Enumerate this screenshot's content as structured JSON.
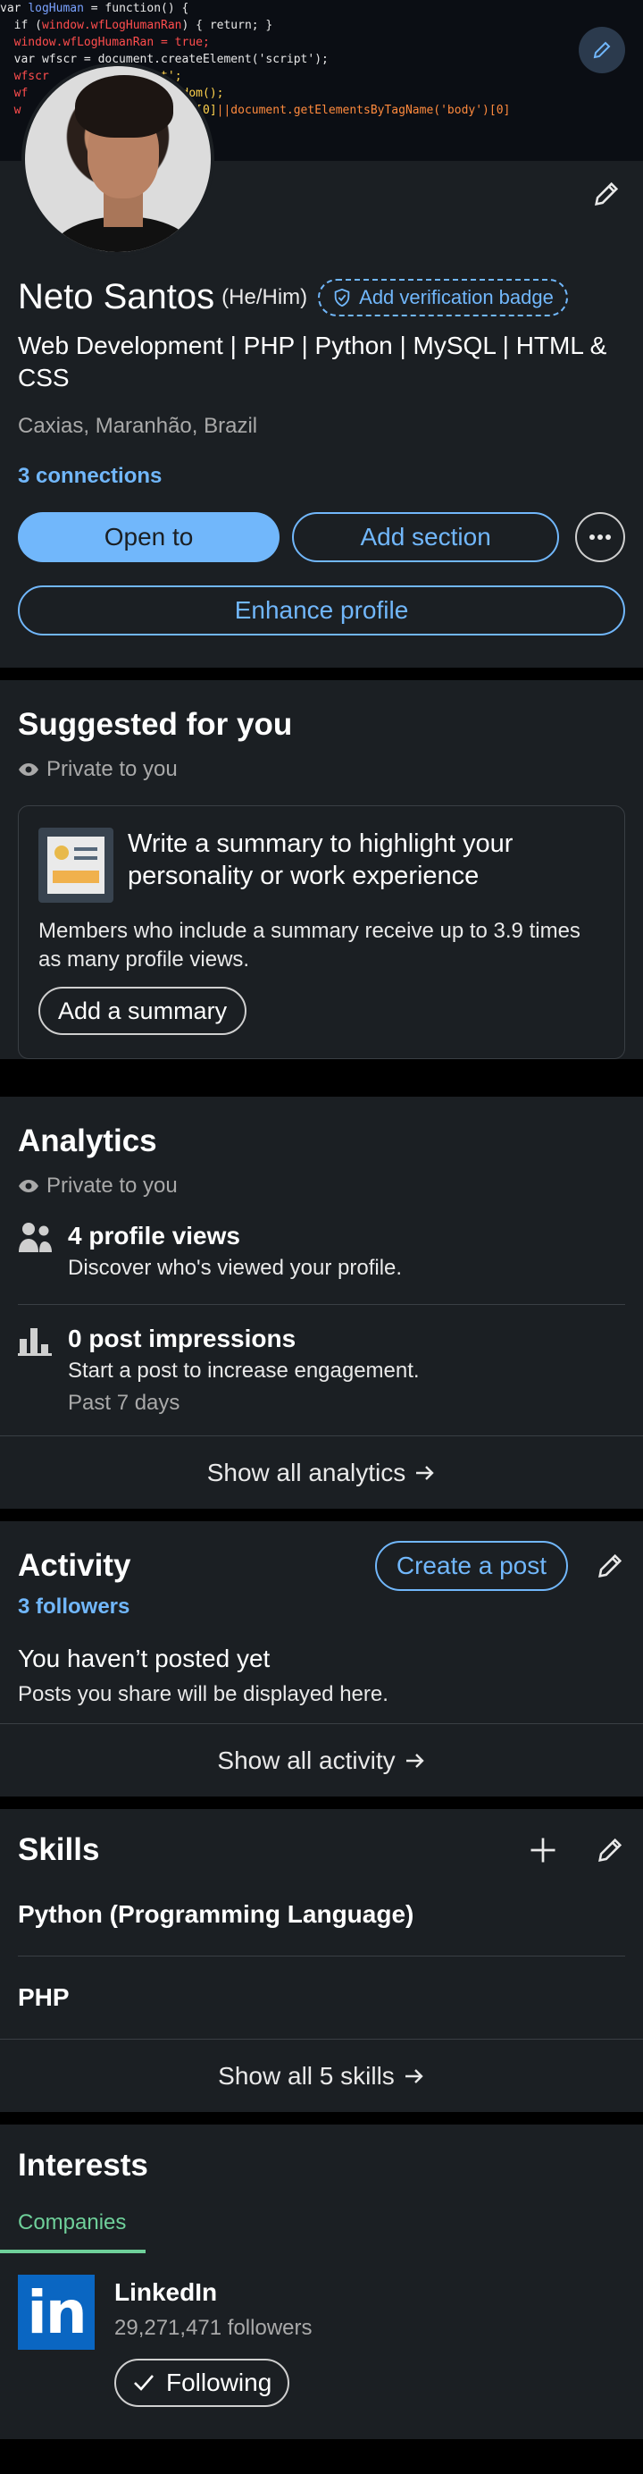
{
  "profile": {
    "name": "Neto Santos",
    "pronouns": "(He/Him)",
    "verification_badge": "Add verification badge",
    "headline": "Web Development | PHP | Python | MySQL | HTML & CSS",
    "location": "Caxias, Maranhão, Brazil",
    "connections": "3 connections",
    "buttons": {
      "open_to": "Open to",
      "add_section": "Add section",
      "enhance": "Enhance profile"
    }
  },
  "suggested": {
    "title": "Suggested for you",
    "privacy": "Private to you",
    "card_title": "Write a summary to highlight your personality or work experience",
    "card_body": "Members who include a summary receive up to 3.9 times as many profile views.",
    "card_button": "Add a summary"
  },
  "analytics": {
    "title": "Analytics",
    "privacy": "Private to you",
    "items": [
      {
        "title": "4 profile views",
        "desc": "Discover who's viewed your profile.",
        "note": ""
      },
      {
        "title": "0 post impressions",
        "desc": "Start a post to increase engagement.",
        "note": "Past 7 days"
      }
    ],
    "show_all": "Show all analytics"
  },
  "activity": {
    "title": "Activity",
    "create_post": "Create a post",
    "followers": "3 followers",
    "empty_title": "You haven’t posted yet",
    "empty_sub": "Posts you share will be displayed here.",
    "show_all": "Show all activity"
  },
  "skills": {
    "title": "Skills",
    "items": [
      "Python (Programming Language)",
      "PHP"
    ],
    "show_all": "Show all 5 skills"
  },
  "interests": {
    "title": "Interests",
    "tab": "Companies",
    "company": {
      "logo_text": "in",
      "name": "LinkedIn",
      "followers": "29,271,471 followers",
      "button": "Following"
    }
  },
  "colors": {
    "accent": "#71b7fb",
    "background": "#1b1f23",
    "tab_active": "#6fd09a"
  }
}
